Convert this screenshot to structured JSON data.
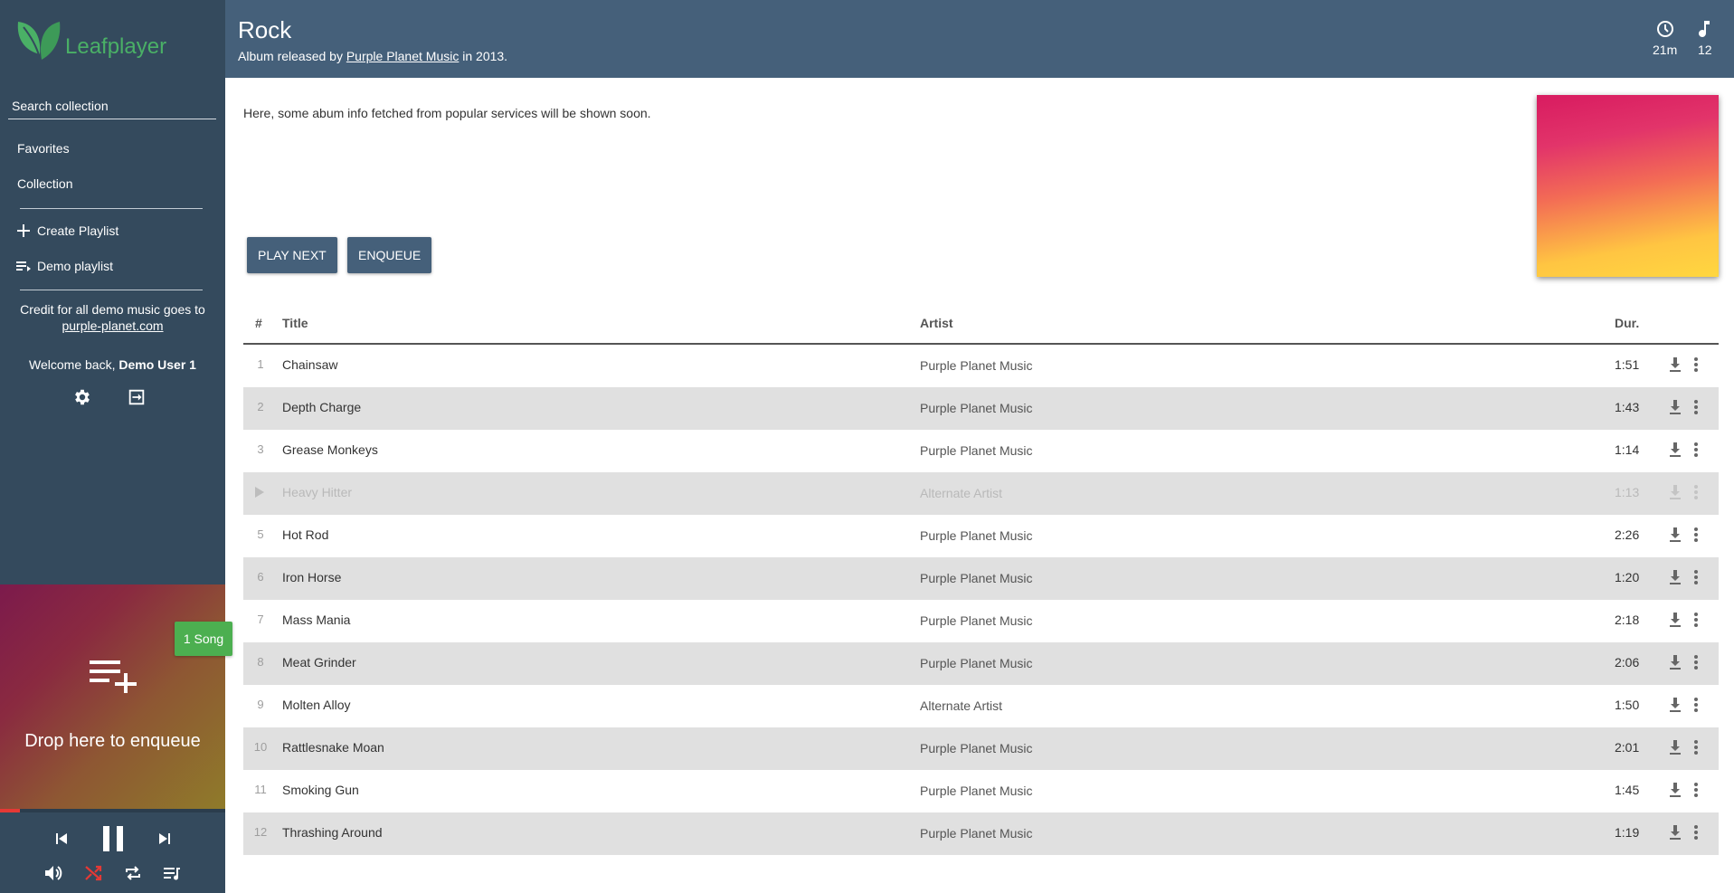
{
  "app": {
    "name": "Leafplayer",
    "logo_color": "#4ab066"
  },
  "sidebar": {
    "search_placeholder": "Search collection",
    "nav": [
      {
        "label": "Favorites"
      },
      {
        "label": "Collection"
      }
    ],
    "playlists": [
      {
        "label": "Create Playlist",
        "icon": "plus-icon"
      },
      {
        "label": "Demo playlist",
        "icon": "playlist-icon"
      }
    ],
    "credit_text": "Credit for all demo music goes to",
    "credit_link": "purple-planet.com",
    "welcome_prefix": "Welcome back,",
    "welcome_user": "Demo User 1",
    "icons": [
      "settings-icon",
      "logout-icon"
    ]
  },
  "dropzone": {
    "text": "Drop here to enqueue",
    "badge": "1 Song",
    "progress": 0.09
  },
  "player": {
    "controls": [
      "skip-previous-icon",
      "pause-icon",
      "skip-next-icon"
    ],
    "secondary": [
      "volume-icon",
      "shuffle-icon",
      "repeat-icon",
      "queue-icon"
    ],
    "shuffle_color": "#e53935"
  },
  "header": {
    "title": "Rock",
    "subtitle_prefix": "Album released by",
    "artist_link": "Purple Planet Music",
    "subtitle_suffix": "in 2013.",
    "duration": "21m",
    "song_count": "12"
  },
  "main": {
    "info_text": "Here, some abum info fetched from popular services will be shown soon.",
    "play_next": "PLAY NEXT",
    "enqueue": "ENQUEUE"
  },
  "table": {
    "headers": {
      "num": "#",
      "title": "Title",
      "artist": "Artist",
      "dur": "Dur."
    },
    "rows": [
      {
        "num": "1",
        "title": "Chainsaw",
        "artist": "Purple Planet Music",
        "dur": "1:51"
      },
      {
        "num": "2",
        "title": "Depth Charge",
        "artist": "Purple Planet Music",
        "dur": "1:43"
      },
      {
        "num": "3",
        "title": "Grease Monkeys",
        "artist": "Purple Planet Music",
        "dur": "1:14"
      },
      {
        "num": "",
        "title": "Heavy Hitter",
        "artist": "Alternate Artist",
        "dur": "1:13",
        "playing": true
      },
      {
        "num": "5",
        "title": "Hot Rod",
        "artist": "Purple Planet Music",
        "dur": "2:26"
      },
      {
        "num": "6",
        "title": "Iron Horse",
        "artist": "Purple Planet Music",
        "dur": "1:20"
      },
      {
        "num": "7",
        "title": "Mass Mania",
        "artist": "Purple Planet Music",
        "dur": "2:18"
      },
      {
        "num": "8",
        "title": "Meat Grinder",
        "artist": "Purple Planet Music",
        "dur": "2:06"
      },
      {
        "num": "9",
        "title": "Molten Alloy",
        "artist": "Alternate Artist",
        "dur": "1:50"
      },
      {
        "num": "10",
        "title": "Rattlesnake Moan",
        "artist": "Purple Planet Music",
        "dur": "2:01"
      },
      {
        "num": "11",
        "title": "Smoking Gun",
        "artist": "Purple Planet Music",
        "dur": "1:45"
      },
      {
        "num": "12",
        "title": "Thrashing Around",
        "artist": "Purple Planet Music",
        "dur": "1:19"
      }
    ]
  }
}
